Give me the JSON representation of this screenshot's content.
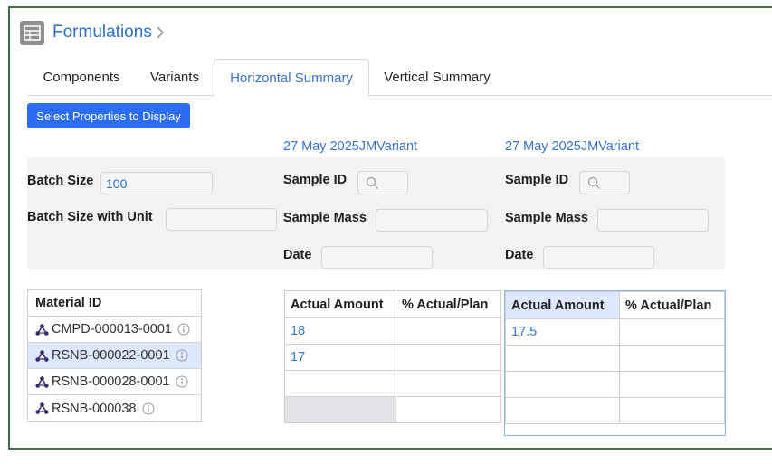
{
  "header": {
    "title": "Formulations",
    "icon": "table-icon"
  },
  "tabs": [
    {
      "label": "Components"
    },
    {
      "label": "Variants"
    },
    {
      "label": "Horizontal Summary",
      "active": true
    },
    {
      "label": "Vertical Summary"
    }
  ],
  "toolbar": {
    "select_properties_label": "Select Properties to Display"
  },
  "batch": {
    "batch_size_label": "Batch Size",
    "batch_size_value": "100",
    "batch_size_unit_label": "Batch Size with Unit",
    "batch_size_unit_value": ""
  },
  "variants": [
    {
      "name": "27 May 2025JMVariant",
      "sample_id_label": "Sample ID",
      "sample_mass_label": "Sample Mass",
      "date_label": "Date",
      "columns": [
        "Actual Amount",
        "% Actual/Plan"
      ],
      "rows": [
        [
          "18",
          ""
        ],
        [
          "17",
          ""
        ],
        [
          "",
          ""
        ],
        [
          "",
          ""
        ]
      ]
    },
    {
      "name": "27 May 2025JMVariant",
      "sample_id_label": "Sample ID",
      "sample_mass_label": "Sample Mass",
      "date_label": "Date",
      "columns": [
        "Actual Amount",
        "% Actual/Plan"
      ],
      "rows": [
        [
          "17.5",
          ""
        ],
        [
          "",
          ""
        ],
        [
          "",
          ""
        ],
        [
          "",
          ""
        ]
      ]
    }
  ],
  "materials": {
    "header": "Material ID",
    "items": [
      {
        "id": "CMPD-000013-0001"
      },
      {
        "id": "RSNB-000022-0001",
        "selected": true
      },
      {
        "id": "RSNB-000028-0001"
      },
      {
        "id": "RSNB-000038"
      }
    ]
  },
  "colors": {
    "accent": "#2b6cf2",
    "link": "#3a72c9",
    "frame": "#3f6b47"
  }
}
